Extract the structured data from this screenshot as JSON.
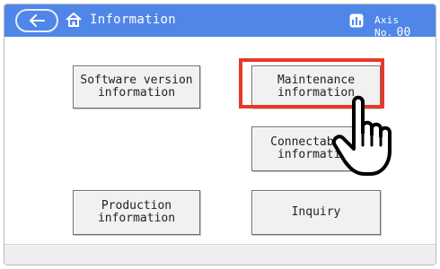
{
  "header": {
    "title": "Information",
    "axis_label": "Axis No.",
    "axis_value": "00",
    "icons": [
      "back-arrow-icon",
      "home-icon",
      "axis-icon"
    ],
    "color": "#4f86e8"
  },
  "buttons": {
    "software_version": "Software version\ninformation",
    "maintenance": "Maintenance\ninformation",
    "connectable": "Connectable m\ninformation",
    "production": "Production\ninformation",
    "inquiry": "Inquiry"
  },
  "annotation": {
    "highlight_color": "#e8392a",
    "pointer_icon": "hand-pointer-icon"
  }
}
